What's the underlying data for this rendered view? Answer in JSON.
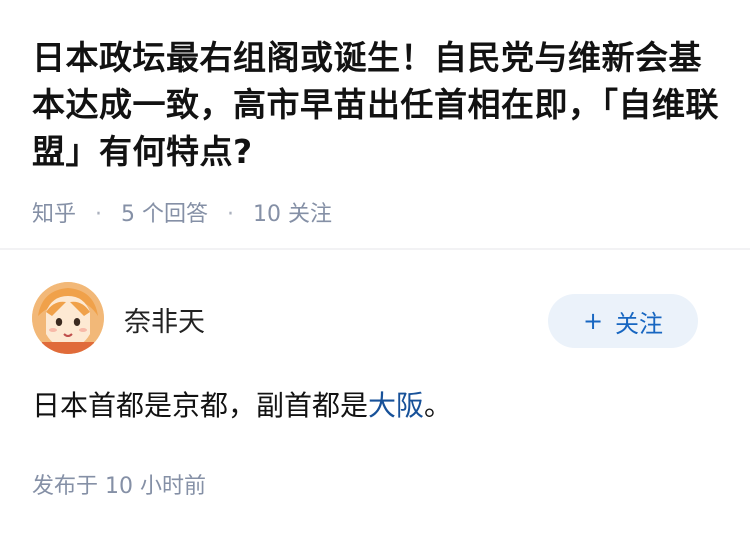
{
  "question": {
    "title": "日本政坛最右组阁或诞生！自民党与维新会基本达成一致，高市早苗出任首相在即，「自维联盟」有何特点?",
    "source": "知乎",
    "answer_count": "5 个回答",
    "follower_count": "10 关注"
  },
  "answer": {
    "author_name": "奈非天",
    "follow_label": "关注",
    "text_before_link": "日本首都是京都，副首都是",
    "link_text": "大阪",
    "text_after_link": "。",
    "posted_label": "发布于",
    "posted_time": "10 小时前"
  },
  "colors": {
    "accent": "#1766c1",
    "link": "#175199",
    "meta": "#8590a6",
    "follow_bg": "#ebf2fa"
  },
  "icons": {
    "follow": "plus-icon",
    "avatar": "anime-character-avatar"
  }
}
